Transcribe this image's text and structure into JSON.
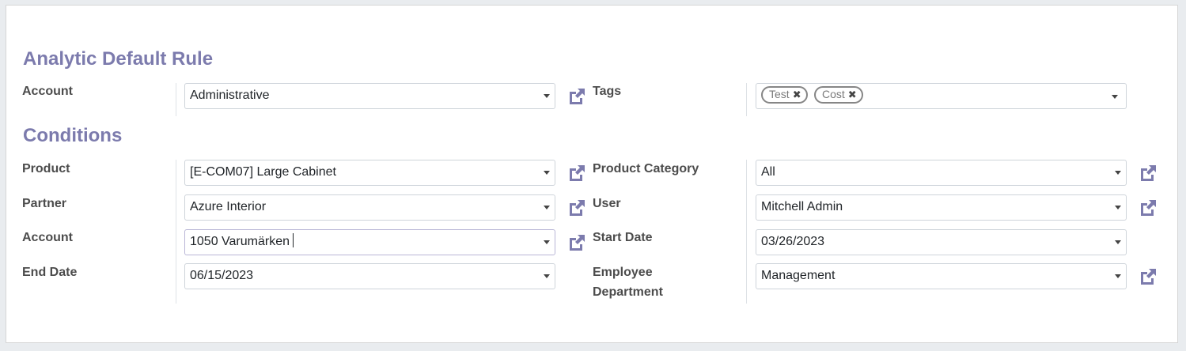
{
  "sections": {
    "rule_title": "Analytic Default Rule",
    "conditions_title": "Conditions"
  },
  "rule": {
    "account_label": "Account",
    "account_value": "Administrative",
    "tags_label": "Tags",
    "tags": [
      "Test",
      "Cost"
    ]
  },
  "conditions": {
    "product_label": "Product",
    "product_value": "[E-COM07] Large Cabinet",
    "product_category_label": "Product Category",
    "product_category_value": "All",
    "partner_label": "Partner",
    "partner_value": "Azure Interior",
    "user_label": "User",
    "user_value": "Mitchell Admin",
    "account_label": "Account",
    "account_value": "1050 Varumärken",
    "start_date_label": "Start Date",
    "start_date_value": "03/26/2023",
    "end_date_label": "End Date",
    "end_date_value": "06/15/2023",
    "employee_department_label_line1": "Employee",
    "employee_department_label_line2": "Department",
    "employee_department_value": "Management"
  },
  "icons": {
    "external_link": "external-link-icon",
    "dropdown": "caret-down-icon",
    "tag_remove": "close-icon"
  },
  "colors": {
    "accent": "#7c7bad",
    "label": "#4c4c4c",
    "border": "#ced4da"
  }
}
